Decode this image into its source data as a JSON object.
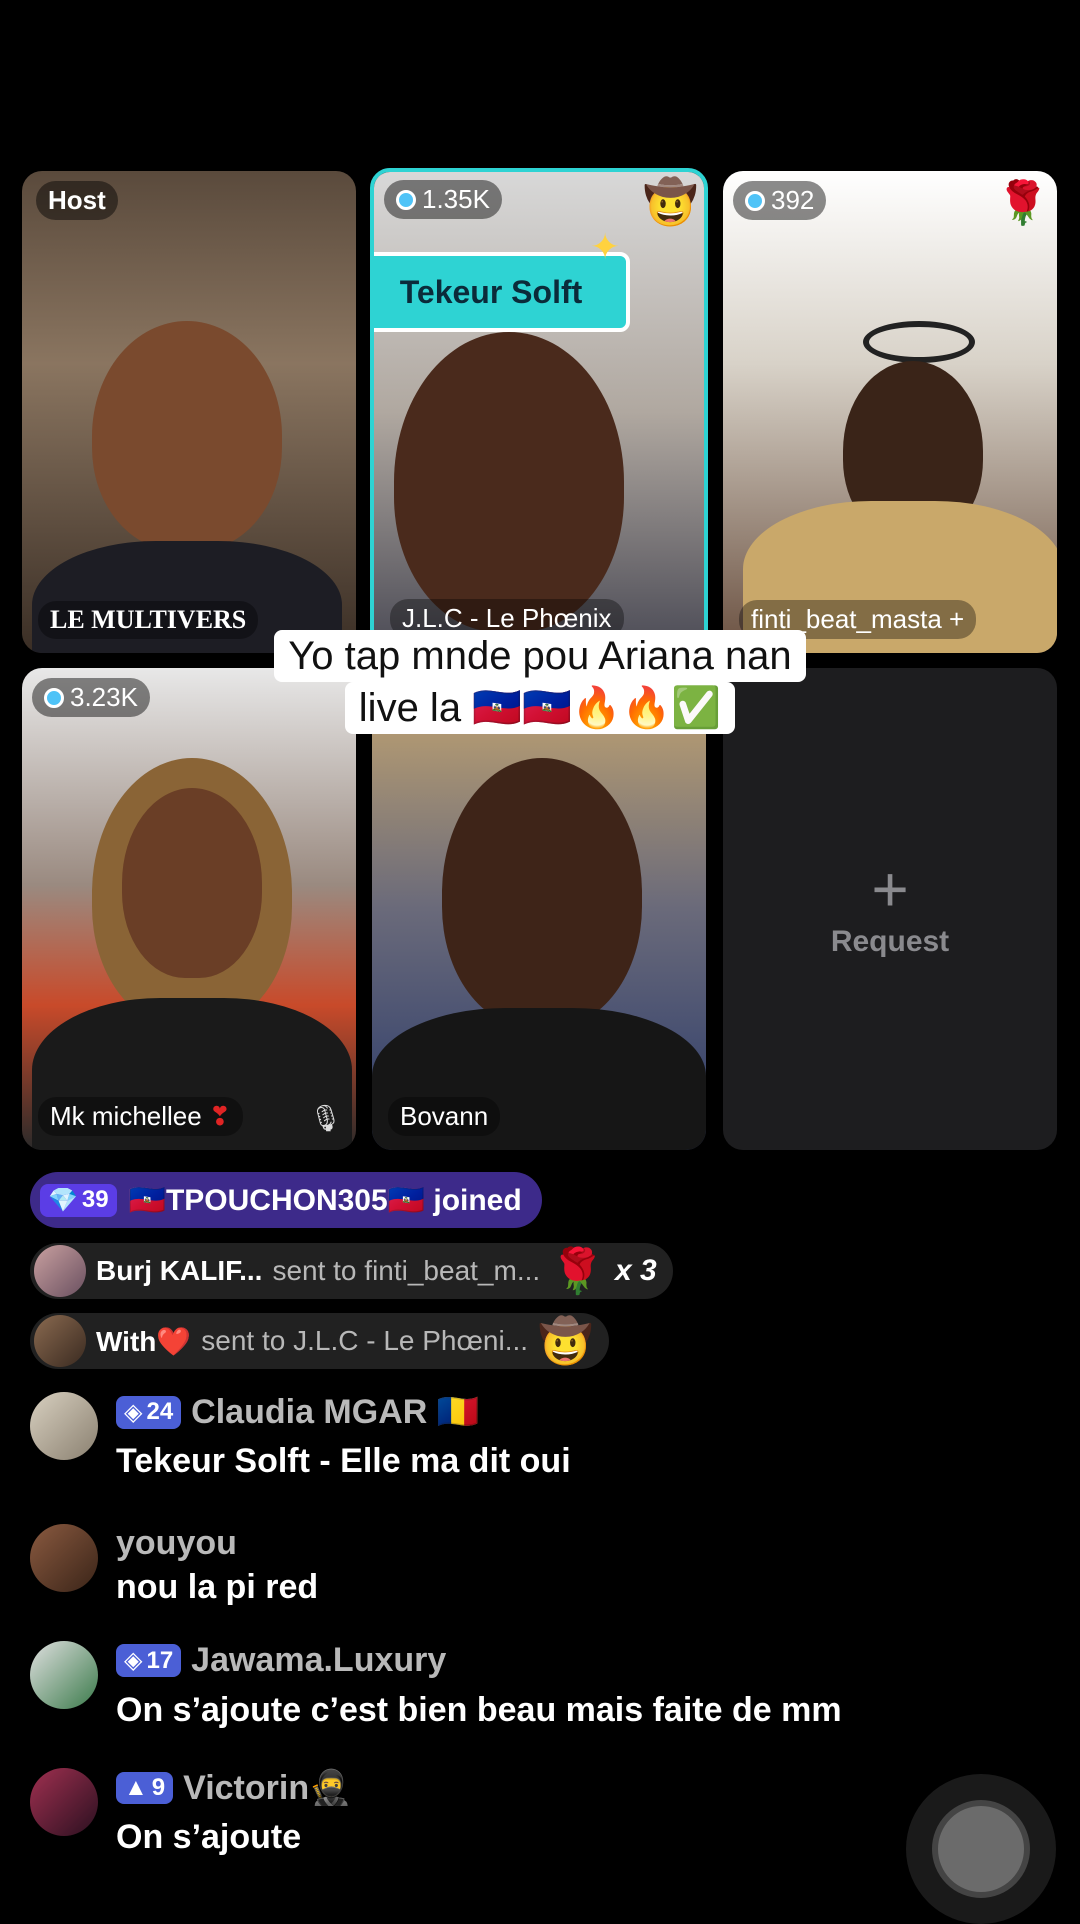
{
  "tiles": [
    {
      "name": "LE MULTIVERS",
      "badge": "Host"
    },
    {
      "name": "J.L.C - Le Phœnix",
      "count": "1.35K",
      "banner": "Tekeur Solft"
    },
    {
      "name": "finti_beat_masta",
      "count": "392"
    },
    {
      "name": "Mk michellee",
      "count": "3.23K"
    },
    {
      "name": "Bovann"
    }
  ],
  "request": {
    "label": "Request"
  },
  "caption": {
    "line1": "Yo tap mnde pou Ariana nan",
    "line2": "live la 🇭🇹🇭🇹🔥🔥✅"
  },
  "join": {
    "level": "39",
    "text": "🇭🇹TPOUCHON305🇭🇹 joined"
  },
  "gifts": [
    {
      "user": "Burj KALIF...",
      "text": "sent to finti_beat_m...",
      "icon": "🌹",
      "count": "x 3"
    },
    {
      "user": "With❤️",
      "text": "sent to J.L.C - Le Phœni...",
      "icon": "🤠",
      "count": ""
    }
  ],
  "comments": [
    {
      "level": "24",
      "user": "Claudia MGAR 🇷🇴",
      "text": "Tekeur Solft - Elle ma dit oui"
    },
    {
      "level": "",
      "user": "youyou",
      "text": "nou la pi red"
    },
    {
      "level": "17",
      "user": "Jawama.Luxury",
      "text": "On s’ajoute c’est bien beau mais faite de mm"
    },
    {
      "level": "9",
      "user": "Victorin🥷",
      "text": "On s’ajoute"
    }
  ],
  "colors": {
    "accent": "#2ed3d3",
    "join_bg": "#3d2a8a",
    "badge": "#4b5fd6",
    "request_bg": "#1d1d1f"
  }
}
